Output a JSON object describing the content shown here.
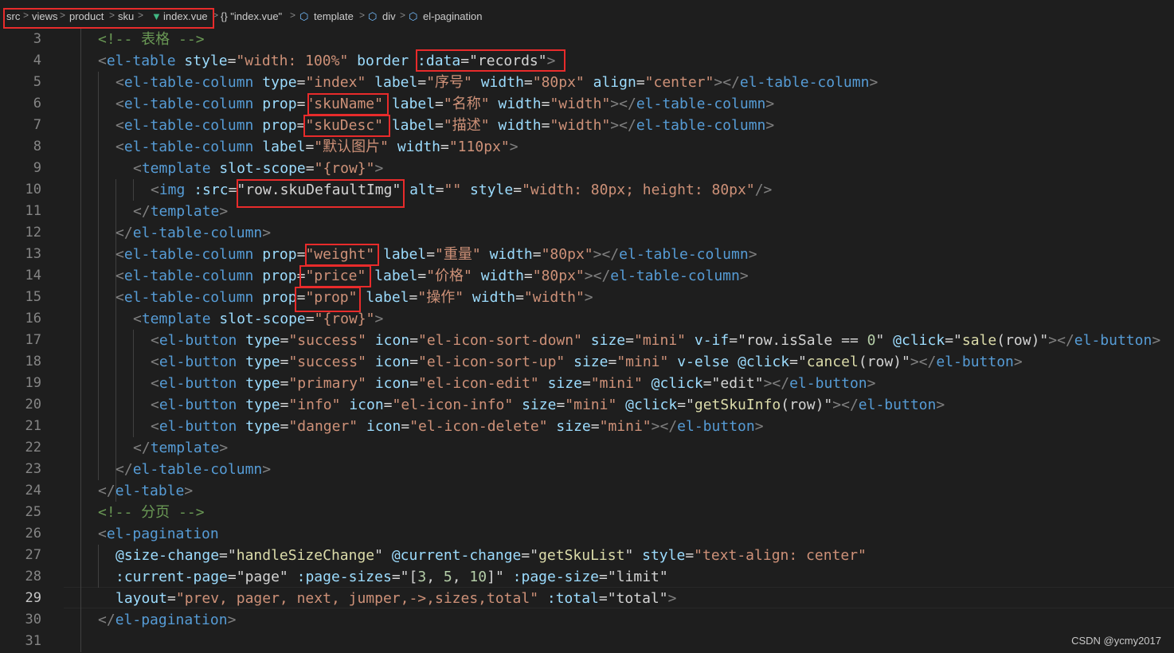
{
  "breadcrumb": {
    "items": [
      "src",
      "views",
      "product",
      "sku",
      "index.vue",
      "{} \"index.vue\"",
      "template",
      "div",
      "el-pagination"
    ],
    "separator": ">",
    "vue_icon": "vue-logo-icon",
    "symbol_icon": "cube-symbol-icon"
  },
  "line_numbers": [
    "3",
    "4",
    "5",
    "6",
    "7",
    "8",
    "9",
    "10",
    "11",
    "12",
    "13",
    "14",
    "15",
    "16",
    "17",
    "18",
    "19",
    "20",
    "21",
    "22",
    "23",
    "24",
    "25",
    "26",
    "27",
    "28",
    "29",
    "30",
    "31"
  ],
  "active_line": "29",
  "code": [
    [
      [
        "cm",
        "<!-- 表格 -->"
      ]
    ],
    [
      [
        "br",
        "<"
      ],
      [
        "tag",
        "el-table"
      ],
      [
        "t",
        " "
      ],
      [
        "at",
        "style"
      ],
      [
        "t",
        "="
      ],
      [
        "st",
        "\"width: 100%\""
      ],
      [
        "t",
        " "
      ],
      [
        "at",
        "border"
      ],
      [
        "t",
        " "
      ],
      [
        "at",
        ":data"
      ],
      [
        "t",
        "="
      ],
      [
        "t",
        "\"records\""
      ],
      [
        "br",
        ">"
      ]
    ],
    [
      [
        "br",
        "<"
      ],
      [
        "tag",
        "el-table-column"
      ],
      [
        "t",
        " "
      ],
      [
        "at",
        "type"
      ],
      [
        "t",
        "="
      ],
      [
        "st",
        "\"index\""
      ],
      [
        "t",
        " "
      ],
      [
        "at",
        "label"
      ],
      [
        "t",
        "="
      ],
      [
        "st",
        "\"序号\""
      ],
      [
        "t",
        " "
      ],
      [
        "at",
        "width"
      ],
      [
        "t",
        "="
      ],
      [
        "st",
        "\"80px\""
      ],
      [
        "t",
        " "
      ],
      [
        "at",
        "align"
      ],
      [
        "t",
        "="
      ],
      [
        "st",
        "\"center\""
      ],
      [
        "br",
        "></"
      ],
      [
        "tag",
        "el-table-column"
      ],
      [
        "br",
        ">"
      ]
    ],
    [
      [
        "br",
        "<"
      ],
      [
        "tag",
        "el-table-column"
      ],
      [
        "t",
        " "
      ],
      [
        "at",
        "prop"
      ],
      [
        "t",
        "="
      ],
      [
        "st",
        "\"skuName\""
      ],
      [
        "t",
        " "
      ],
      [
        "at",
        "label"
      ],
      [
        "t",
        "="
      ],
      [
        "st",
        "\"名称\""
      ],
      [
        "t",
        " "
      ],
      [
        "at",
        "width"
      ],
      [
        "t",
        "="
      ],
      [
        "st",
        "\"width\""
      ],
      [
        "br",
        "></"
      ],
      [
        "tag",
        "el-table-column"
      ],
      [
        "br",
        ">"
      ]
    ],
    [
      [
        "br",
        "<"
      ],
      [
        "tag",
        "el-table-column"
      ],
      [
        "t",
        " "
      ],
      [
        "at",
        "prop"
      ],
      [
        "t",
        "="
      ],
      [
        "st",
        "\"skuDesc\""
      ],
      [
        "t",
        " "
      ],
      [
        "at",
        "label"
      ],
      [
        "t",
        "="
      ],
      [
        "st",
        "\"描述\""
      ],
      [
        "t",
        " "
      ],
      [
        "at",
        "width"
      ],
      [
        "t",
        "="
      ],
      [
        "st",
        "\"width\""
      ],
      [
        "br",
        "></"
      ],
      [
        "tag",
        "el-table-column"
      ],
      [
        "br",
        ">"
      ]
    ],
    [
      [
        "br",
        "<"
      ],
      [
        "tag",
        "el-table-column"
      ],
      [
        "t",
        " "
      ],
      [
        "at",
        "label"
      ],
      [
        "t",
        "="
      ],
      [
        "st",
        "\"默认图片\""
      ],
      [
        "t",
        " "
      ],
      [
        "at",
        "width"
      ],
      [
        "t",
        "="
      ],
      [
        "st",
        "\"110px\""
      ],
      [
        "br",
        ">"
      ]
    ],
    [
      [
        "br",
        "<"
      ],
      [
        "tag",
        "template"
      ],
      [
        "t",
        " "
      ],
      [
        "at",
        "slot-scope"
      ],
      [
        "t",
        "="
      ],
      [
        "st",
        "\"{row}\""
      ],
      [
        "br",
        ">"
      ]
    ],
    [
      [
        "br",
        "<"
      ],
      [
        "tag",
        "img"
      ],
      [
        "t",
        " "
      ],
      [
        "at",
        ":src"
      ],
      [
        "t",
        "="
      ],
      [
        "t",
        "\"row.skuDefaultImg\""
      ],
      [
        "t",
        " "
      ],
      [
        "at",
        "alt"
      ],
      [
        "t",
        "="
      ],
      [
        "st",
        "\"\""
      ],
      [
        "t",
        " "
      ],
      [
        "at",
        "style"
      ],
      [
        "t",
        "="
      ],
      [
        "st",
        "\"width: 80px; height: 80px\""
      ],
      [
        "br",
        "/>"
      ]
    ],
    [
      [
        "br",
        "</"
      ],
      [
        "tag",
        "template"
      ],
      [
        "br",
        ">"
      ]
    ],
    [
      [
        "br",
        "</"
      ],
      [
        "tag",
        "el-table-column"
      ],
      [
        "br",
        ">"
      ]
    ],
    [
      [
        "br",
        "<"
      ],
      [
        "tag",
        "el-table-column"
      ],
      [
        "t",
        " "
      ],
      [
        "at",
        "prop"
      ],
      [
        "t",
        "="
      ],
      [
        "st",
        "\"weight\""
      ],
      [
        "t",
        " "
      ],
      [
        "at",
        "label"
      ],
      [
        "t",
        "="
      ],
      [
        "st",
        "\"重量\""
      ],
      [
        "t",
        " "
      ],
      [
        "at",
        "width"
      ],
      [
        "t",
        "="
      ],
      [
        "st",
        "\"80px\""
      ],
      [
        "br",
        "></"
      ],
      [
        "tag",
        "el-table-column"
      ],
      [
        "br",
        ">"
      ]
    ],
    [
      [
        "br",
        "<"
      ],
      [
        "tag",
        "el-table-column"
      ],
      [
        "t",
        " "
      ],
      [
        "at",
        "prop"
      ],
      [
        "t",
        "="
      ],
      [
        "st",
        "\"price\""
      ],
      [
        "t",
        " "
      ],
      [
        "at",
        "label"
      ],
      [
        "t",
        "="
      ],
      [
        "st",
        "\"价格\""
      ],
      [
        "t",
        " "
      ],
      [
        "at",
        "width"
      ],
      [
        "t",
        "="
      ],
      [
        "st",
        "\"80px\""
      ],
      [
        "br",
        "></"
      ],
      [
        "tag",
        "el-table-column"
      ],
      [
        "br",
        ">"
      ]
    ],
    [
      [
        "br",
        "<"
      ],
      [
        "tag",
        "el-table-column"
      ],
      [
        "t",
        " "
      ],
      [
        "at",
        "prop"
      ],
      [
        "t",
        "="
      ],
      [
        "st",
        "\"prop\""
      ],
      [
        "t",
        " "
      ],
      [
        "at",
        "label"
      ],
      [
        "t",
        "="
      ],
      [
        "st",
        "\"操作\""
      ],
      [
        "t",
        " "
      ],
      [
        "at",
        "width"
      ],
      [
        "t",
        "="
      ],
      [
        "st",
        "\"width\""
      ],
      [
        "br",
        ">"
      ]
    ],
    [
      [
        "br",
        "<"
      ],
      [
        "tag",
        "template"
      ],
      [
        "t",
        " "
      ],
      [
        "at",
        "slot-scope"
      ],
      [
        "t",
        "="
      ],
      [
        "st",
        "\"{row}\""
      ],
      [
        "br",
        ">"
      ]
    ],
    [
      [
        "br",
        "<"
      ],
      [
        "tag",
        "el-button"
      ],
      [
        "t",
        " "
      ],
      [
        "at",
        "type"
      ],
      [
        "t",
        "="
      ],
      [
        "st",
        "\"success\""
      ],
      [
        "t",
        " "
      ],
      [
        "at",
        "icon"
      ],
      [
        "t",
        "="
      ],
      [
        "st",
        "\"el-icon-sort-down\""
      ],
      [
        "t",
        " "
      ],
      [
        "at",
        "size"
      ],
      [
        "t",
        "="
      ],
      [
        "st",
        "\"mini\""
      ],
      [
        "t",
        " "
      ],
      [
        "at",
        "v-if"
      ],
      [
        "t",
        "="
      ],
      [
        "t",
        "\"row.isSale == "
      ],
      [
        "nm",
        "0"
      ],
      [
        "t",
        "\""
      ],
      [
        "t",
        " "
      ],
      [
        "at",
        "@click"
      ],
      [
        "t",
        "="
      ],
      [
        "t",
        "\""
      ],
      [
        "fn",
        "sale"
      ],
      [
        "t",
        "(row)\""
      ],
      [
        "br",
        "></"
      ],
      [
        "tag",
        "el-button"
      ],
      [
        "br",
        ">"
      ]
    ],
    [
      [
        "br",
        "<"
      ],
      [
        "tag",
        "el-button"
      ],
      [
        "t",
        " "
      ],
      [
        "at",
        "type"
      ],
      [
        "t",
        "="
      ],
      [
        "st",
        "\"success\""
      ],
      [
        "t",
        " "
      ],
      [
        "at",
        "icon"
      ],
      [
        "t",
        "="
      ],
      [
        "st",
        "\"el-icon-sort-up\""
      ],
      [
        "t",
        " "
      ],
      [
        "at",
        "size"
      ],
      [
        "t",
        "="
      ],
      [
        "st",
        "\"mini\""
      ],
      [
        "t",
        " "
      ],
      [
        "at",
        "v-else"
      ],
      [
        "t",
        " "
      ],
      [
        "at",
        "@click"
      ],
      [
        "t",
        "="
      ],
      [
        "t",
        "\""
      ],
      [
        "fn",
        "cancel"
      ],
      [
        "t",
        "(row)\""
      ],
      [
        "br",
        "></"
      ],
      [
        "tag",
        "el-button"
      ],
      [
        "br",
        ">"
      ]
    ],
    [
      [
        "br",
        "<"
      ],
      [
        "tag",
        "el-button"
      ],
      [
        "t",
        " "
      ],
      [
        "at",
        "type"
      ],
      [
        "t",
        "="
      ],
      [
        "st",
        "\"primary\""
      ],
      [
        "t",
        " "
      ],
      [
        "at",
        "icon"
      ],
      [
        "t",
        "="
      ],
      [
        "st",
        "\"el-icon-edit\""
      ],
      [
        "t",
        " "
      ],
      [
        "at",
        "size"
      ],
      [
        "t",
        "="
      ],
      [
        "st",
        "\"mini\""
      ],
      [
        "t",
        " "
      ],
      [
        "at",
        "@click"
      ],
      [
        "t",
        "="
      ],
      [
        "t",
        "\"edit\""
      ],
      [
        "br",
        "></"
      ],
      [
        "tag",
        "el-button"
      ],
      [
        "br",
        ">"
      ]
    ],
    [
      [
        "br",
        "<"
      ],
      [
        "tag",
        "el-button"
      ],
      [
        "t",
        " "
      ],
      [
        "at",
        "type"
      ],
      [
        "t",
        "="
      ],
      [
        "st",
        "\"info\""
      ],
      [
        "t",
        " "
      ],
      [
        "at",
        "icon"
      ],
      [
        "t",
        "="
      ],
      [
        "st",
        "\"el-icon-info\""
      ],
      [
        "t",
        " "
      ],
      [
        "at",
        "size"
      ],
      [
        "t",
        "="
      ],
      [
        "st",
        "\"mini\""
      ],
      [
        "t",
        " "
      ],
      [
        "at",
        "@click"
      ],
      [
        "t",
        "="
      ],
      [
        "t",
        "\""
      ],
      [
        "fn",
        "getSkuInfo"
      ],
      [
        "t",
        "(row)\""
      ],
      [
        "br",
        "></"
      ],
      [
        "tag",
        "el-button"
      ],
      [
        "br",
        ">"
      ]
    ],
    [
      [
        "br",
        "<"
      ],
      [
        "tag",
        "el-button"
      ],
      [
        "t",
        " "
      ],
      [
        "at",
        "type"
      ],
      [
        "t",
        "="
      ],
      [
        "st",
        "\"danger\""
      ],
      [
        "t",
        " "
      ],
      [
        "at",
        "icon"
      ],
      [
        "t",
        "="
      ],
      [
        "st",
        "\"el-icon-delete\""
      ],
      [
        "t",
        " "
      ],
      [
        "at",
        "size"
      ],
      [
        "t",
        "="
      ],
      [
        "st",
        "\"mini\""
      ],
      [
        "br",
        "></"
      ],
      [
        "tag",
        "el-button"
      ],
      [
        "br",
        ">"
      ]
    ],
    [
      [
        "br",
        "</"
      ],
      [
        "tag",
        "template"
      ],
      [
        "br",
        ">"
      ]
    ],
    [
      [
        "br",
        "</"
      ],
      [
        "tag",
        "el-table-column"
      ],
      [
        "br",
        ">"
      ]
    ],
    [
      [
        "br",
        "</"
      ],
      [
        "tag",
        "el-table"
      ],
      [
        "br",
        ">"
      ]
    ],
    [
      [
        "cm",
        "<!-- 分页 -->"
      ]
    ],
    [
      [
        "br",
        "<"
      ],
      [
        "tag",
        "el-pagination"
      ]
    ],
    [
      [
        "at",
        "@size-change"
      ],
      [
        "t",
        "="
      ],
      [
        "t",
        "\""
      ],
      [
        "fn",
        "handleSizeChange"
      ],
      [
        "t",
        "\""
      ],
      [
        "t",
        " "
      ],
      [
        "at",
        "@current-change"
      ],
      [
        "t",
        "="
      ],
      [
        "t",
        "\""
      ],
      [
        "fn",
        "getSkuList"
      ],
      [
        "t",
        "\""
      ],
      [
        "t",
        " "
      ],
      [
        "at",
        "style"
      ],
      [
        "t",
        "="
      ],
      [
        "st",
        "\"text-align: center\""
      ]
    ],
    [
      [
        "at",
        ":current-page"
      ],
      [
        "t",
        "="
      ],
      [
        "t",
        "\"page\""
      ],
      [
        "t",
        " "
      ],
      [
        "at",
        ":page-sizes"
      ],
      [
        "t",
        "="
      ],
      [
        "t",
        "\"["
      ],
      [
        "nm",
        "3"
      ],
      [
        "t",
        ", "
      ],
      [
        "nm",
        "5"
      ],
      [
        "t",
        ", "
      ],
      [
        "nm",
        "10"
      ],
      [
        "t",
        "]\""
      ],
      [
        "t",
        " "
      ],
      [
        "at",
        ":page-size"
      ],
      [
        "t",
        "="
      ],
      [
        "t",
        "\"limit\""
      ]
    ],
    [
      [
        "at",
        "layout"
      ],
      [
        "t",
        "="
      ],
      [
        "st",
        "\"prev, pager, next, jumper,->,sizes,total\""
      ],
      [
        "t",
        " "
      ],
      [
        "at",
        ":total"
      ],
      [
        "t",
        "="
      ],
      [
        "t",
        "\"total\""
      ],
      [
        "br",
        ">"
      ]
    ],
    [
      [
        "br",
        "</"
      ],
      [
        "tag",
        "el-pagination"
      ],
      [
        "br",
        ">"
      ]
    ],
    []
  ],
  "watermark": "CSDN @ycmy2017"
}
